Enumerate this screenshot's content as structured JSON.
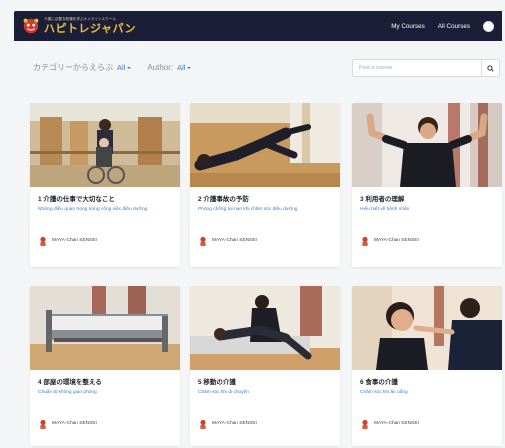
{
  "nav": {
    "logo_subtitle": "介護に必要な知識を学ぶオンラインスクール",
    "logo_text": "ハピトレジャパン",
    "links": [
      "My Courses",
      "All Courses"
    ]
  },
  "filters": {
    "category_label": "カテゴリーからえらぶ",
    "category_value": "All",
    "author_label": "Author:",
    "author_value": "All"
  },
  "search": {
    "placeholder": "Find a course"
  },
  "courses": [
    {
      "title": "1 介護の仕事で大切なこと",
      "subtitle": "Những điều quan trọng trong công việc điều dưỡng",
      "author": "MAYA-Chan SENSEI",
      "image": "corridor-wheelchair"
    },
    {
      "title": "2 介護事故の予防",
      "subtitle": "Phòng chống tai nạn khi chăm sóc điều dưỡng",
      "author": "MAYA-Chan SENSEI",
      "image": "fallen-person"
    },
    {
      "title": "3 利用者の理解",
      "subtitle": "Hiểu biết về bệnh nhân",
      "author": "MAYA-Chan SENSEI",
      "image": "man-arms-raised"
    },
    {
      "title": "4 部屋の環境を整える",
      "subtitle": "Chuẩn bị không gian phòng",
      "author": "MAYA-Chan SENSEI",
      "image": "care-bed"
    },
    {
      "title": "5 移動の介護",
      "subtitle": "Chăm sóc khi di chuyển",
      "author": "MAYA-Chan SENSEI",
      "image": "bed-transfer"
    },
    {
      "title": "6 食事の介護",
      "subtitle": "Chăm sóc khi ăn uống",
      "author": "MAYA-Chan SENSEI",
      "image": "feeding"
    }
  ],
  "colors": {
    "navbar": "#1b1e37",
    "logo": "#f2bf2f",
    "link": "#3b82c4"
  }
}
